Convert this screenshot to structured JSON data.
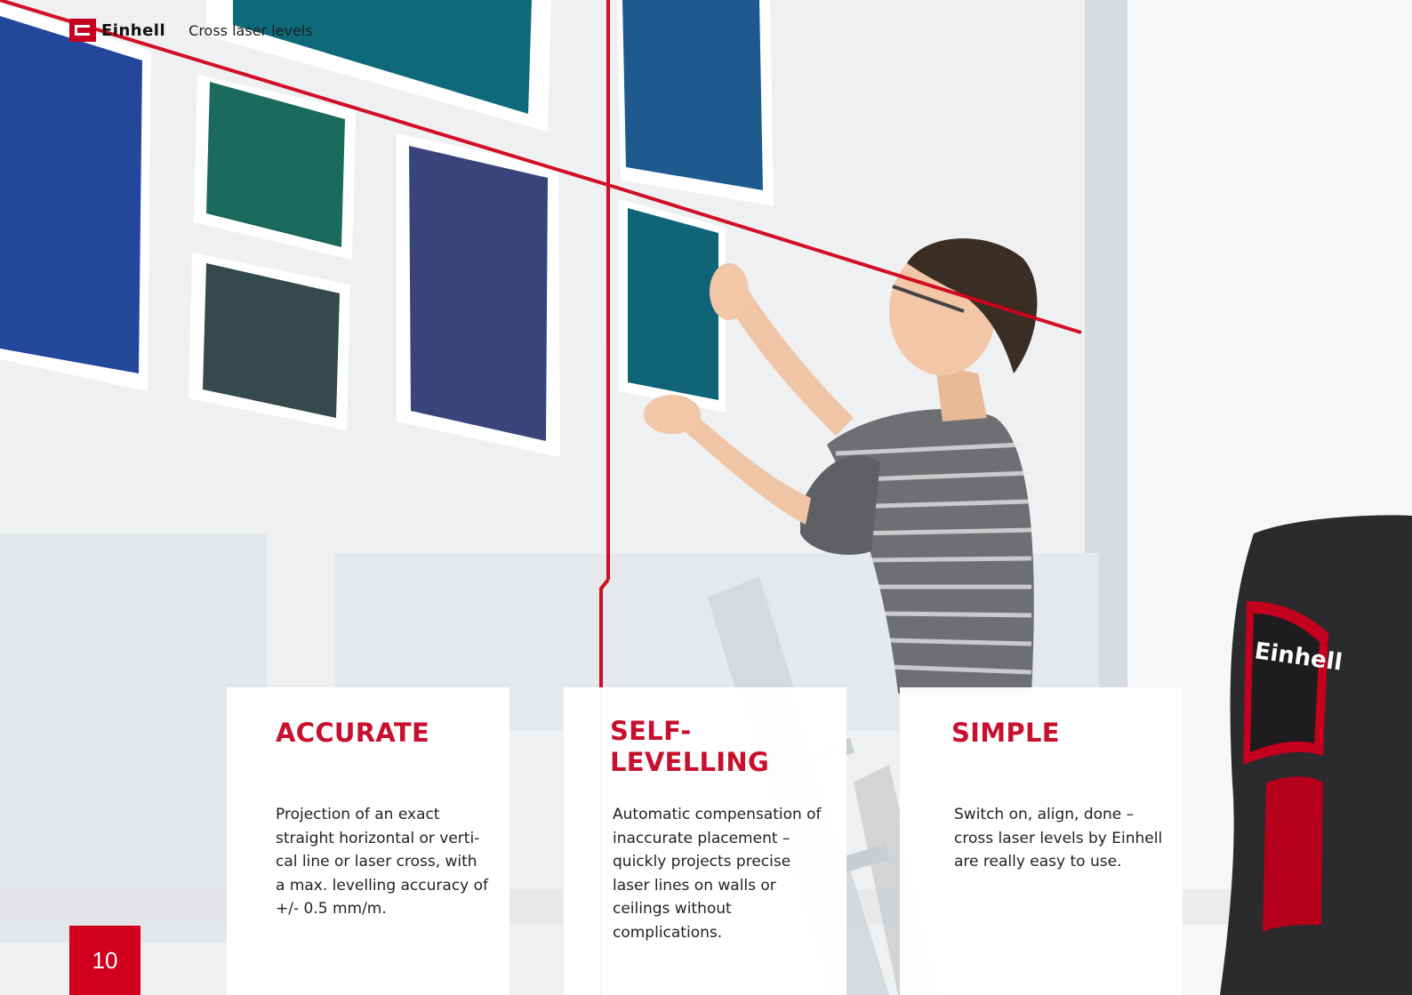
{
  "header": {
    "brand": "Einhell",
    "title": "Cross laser levels"
  },
  "features": [
    {
      "heading": "ACCURATE",
      "text": "Projection of an exact straight horizontal or verti-cal line or laser cross, with a max. levelling accuracy of +/- 0.5 mm/m."
    },
    {
      "heading": "SELF-LEVELLING",
      "text": "Automatic compensation of inaccurate placement – quickly projects precise laser lines on walls or ceilings without complications."
    },
    {
      "heading": "SIMPLE",
      "text": "Switch on, align, done – cross laser levels by Einhell are really easy to use."
    },
    {
      "heading_line1": "SELF-",
      "heading_line2": "LEVELLING"
    }
  ],
  "page": {
    "number": "10"
  },
  "device": {
    "brand": "Einhell"
  },
  "colors": {
    "accent": "#c8102e",
    "laser": "#d0021b"
  }
}
